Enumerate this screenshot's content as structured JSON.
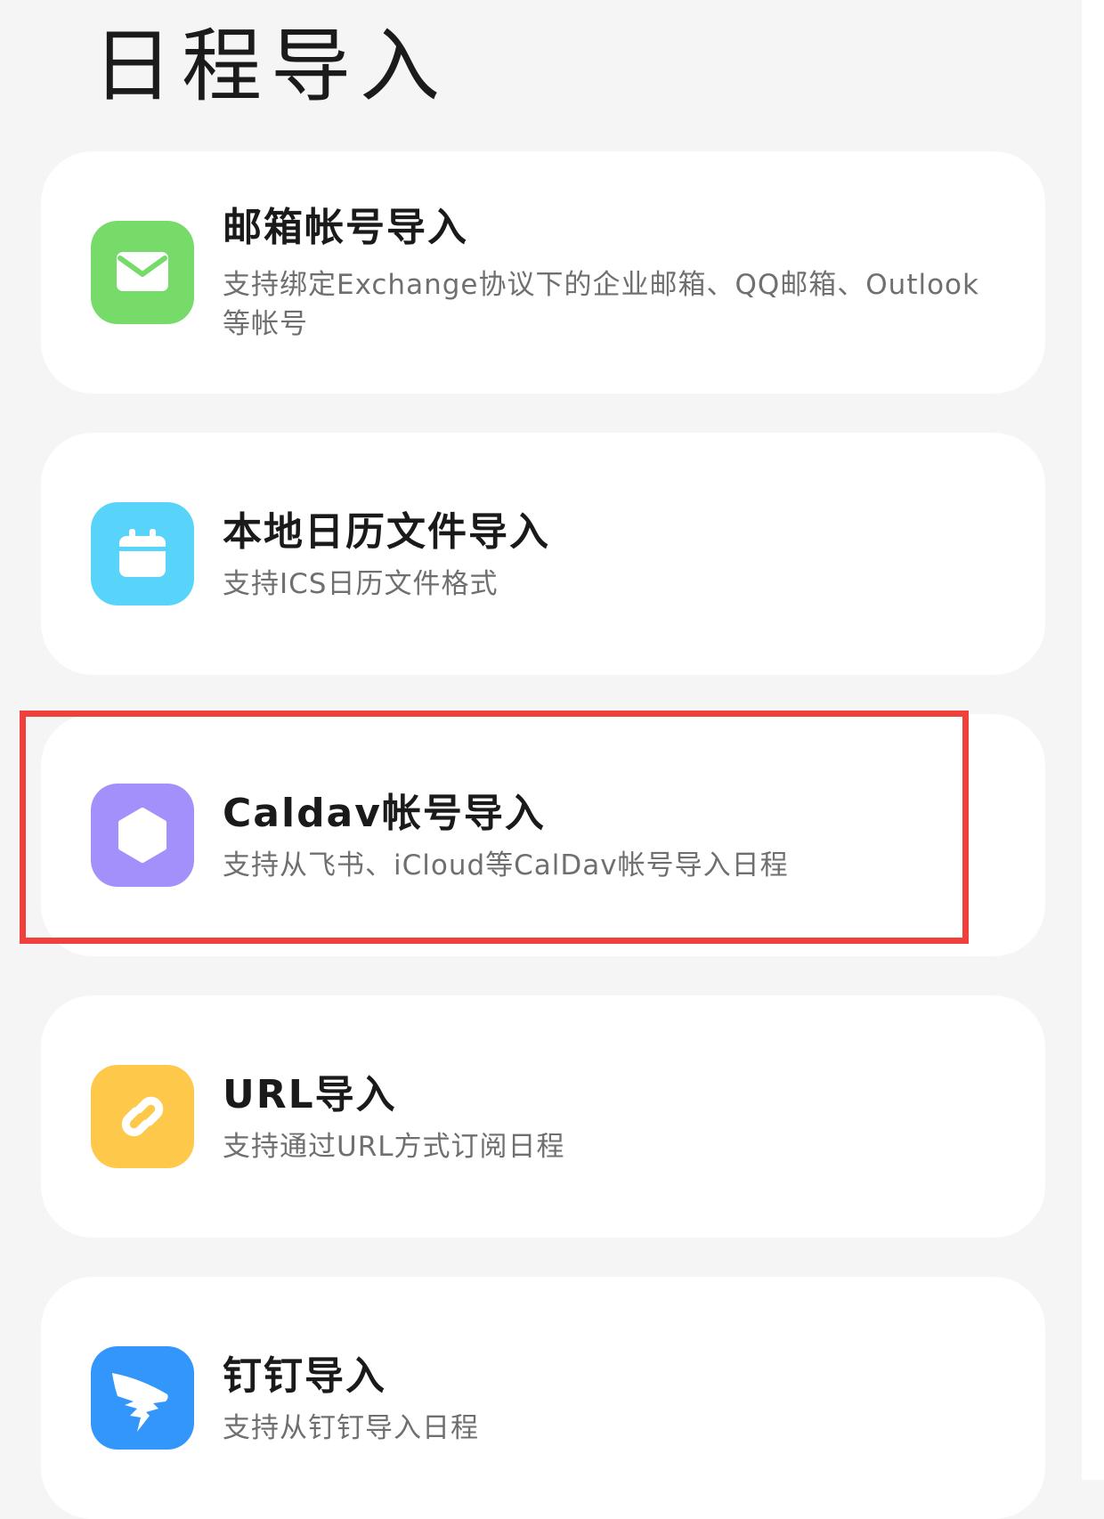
{
  "header": {
    "title": "日程导入"
  },
  "colors": {
    "background": "#f5f5f5",
    "card": "#ffffff",
    "email_icon": "#77db6a",
    "calendar_icon": "#58d4fb",
    "caldav_icon": "#a490fb",
    "url_icon": "#fec84a",
    "dingtalk_icon": "#3296fa",
    "highlight": "#f0403c"
  },
  "options": [
    {
      "title": "邮箱帐号导入",
      "subtitle": "支持绑定Exchange协议下的企业邮箱、QQ邮箱、Outlook等帐号",
      "icon": "mail-icon"
    },
    {
      "title": "本地日历文件导入",
      "subtitle": "支持ICS日历文件格式",
      "icon": "calendar-icon"
    },
    {
      "title": "Caldav帐号导入",
      "subtitle": "支持从飞书、iCloud等CalDav帐号导入日程",
      "icon": "hexagon-icon"
    },
    {
      "title": "URL导入",
      "subtitle": "支持通过URL方式订阅日程",
      "icon": "link-icon"
    },
    {
      "title": "钉钉导入",
      "subtitle": "支持从钉钉导入日程",
      "icon": "dingtalk-icon"
    }
  ]
}
